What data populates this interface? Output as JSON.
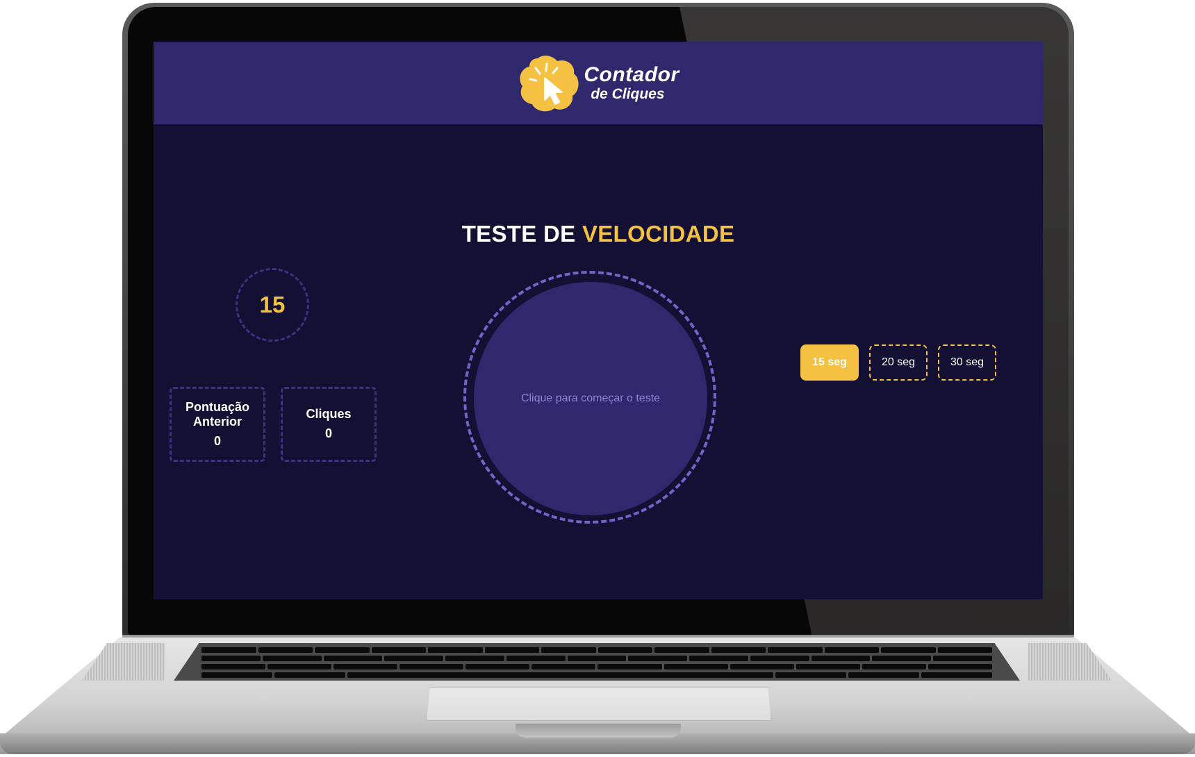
{
  "app": {
    "logo_line1": "Contador",
    "logo_line2": "de Cliques"
  },
  "title": {
    "part1": "TESTE DE ",
    "part2": "VELOCIDADE"
  },
  "timer": {
    "value": "15"
  },
  "stats": {
    "previous_score_label": "Pontuação Anterior",
    "previous_score_value": "0",
    "clicks_label": "Cliques",
    "clicks_value": "0"
  },
  "click_area": {
    "prompt": "Clique para começar o teste"
  },
  "durations": {
    "options": [
      "15 seg",
      "20 seg",
      "30 seg"
    ],
    "selected": "15 seg"
  },
  "colors": {
    "background": "#131033",
    "header": "#30286c",
    "accent": "#f4c142",
    "ring": "#7163c9",
    "muted_text": "#8d80d8"
  },
  "icons": {
    "logo": "cursor-click-star-icon"
  }
}
